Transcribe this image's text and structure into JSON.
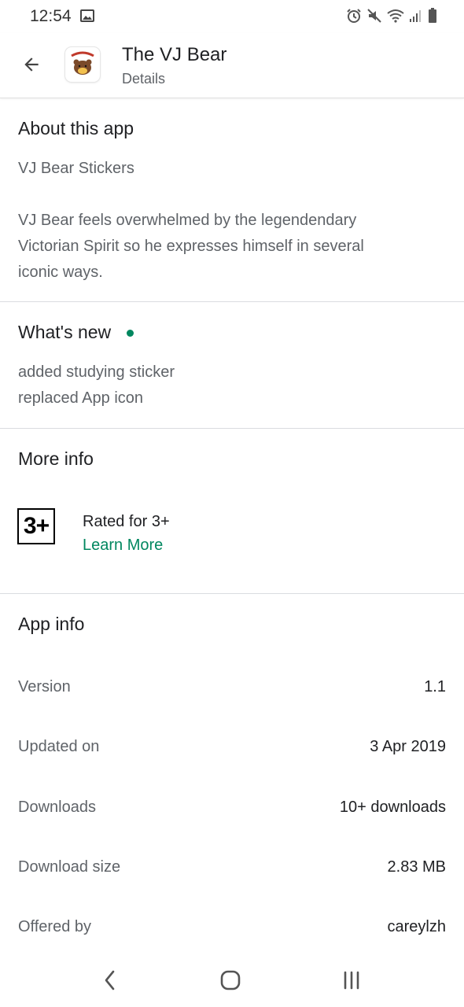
{
  "status_bar": {
    "time": "12:54",
    "icons": [
      "gallery-icon",
      "alarm-icon",
      "mute-icon",
      "wifi-icon",
      "signal-icon",
      "battery-icon"
    ]
  },
  "header": {
    "title": "The VJ Bear",
    "subtitle": "Details",
    "back_icon": "arrow-left-icon"
  },
  "about": {
    "title": "About this app",
    "tagline": "VJ Bear Stickers",
    "description_lines": [
      "VJ Bear feels overwhelmed by the legendendary",
      "Victorian Spirit so he expresses himself in several",
      "iconic ways."
    ]
  },
  "whats_new": {
    "title": "What's new",
    "lines": [
      "added studying sticker",
      "replaced App icon"
    ]
  },
  "more_info": {
    "title": "More info",
    "rating_badge": "3+",
    "rating_label": "Rated for 3+",
    "learn_more": "Learn More"
  },
  "app_info": {
    "title": "App info",
    "rows": [
      {
        "label": "Version",
        "value": "1.1"
      },
      {
        "label": "Updated on",
        "value": "3 Apr 2019"
      },
      {
        "label": "Downloads",
        "value": "10+ downloads"
      },
      {
        "label": "Download size",
        "value": "2.83 MB"
      },
      {
        "label": "Offered by",
        "value": "careylzh"
      }
    ]
  },
  "nav_bar": {
    "buttons": [
      "back-nav-icon",
      "home-nav-icon",
      "recents-nav-icon"
    ]
  },
  "colors": {
    "accent": "#01875f",
    "text_primary": "#202124",
    "text_secondary": "#5f6368",
    "divider": "#dadce0"
  }
}
